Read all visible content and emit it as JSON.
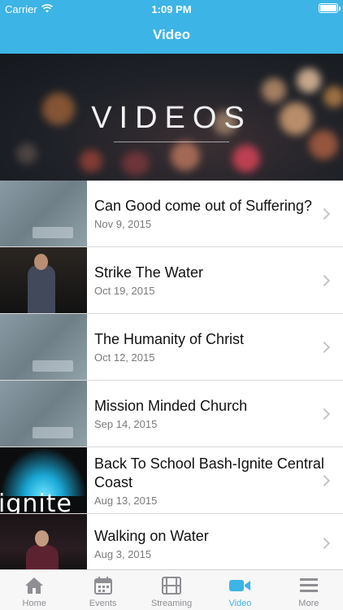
{
  "status_bar": {
    "carrier": "Carrier",
    "time": "1:09 PM"
  },
  "nav": {
    "title": "Video"
  },
  "banner": {
    "text": "VIDEOS"
  },
  "videos": [
    {
      "title": "Can Good come out of Suffering?",
      "date": "Nov 9, 2015",
      "thumb": "scripture"
    },
    {
      "title": "Strike The Water",
      "date": "Oct 19, 2015",
      "thumb": "stage"
    },
    {
      "title": "The Humanity of Christ",
      "date": "Oct 12, 2015",
      "thumb": "scripture"
    },
    {
      "title": "Mission Minded Church",
      "date": "Sep 14, 2015",
      "thumb": "scripture"
    },
    {
      "title": "Back To School Bash-Ignite Central Coast",
      "date": "Aug 13, 2015",
      "thumb": "ignite"
    },
    {
      "title": "Walking on Water",
      "date": "Aug 3, 2015",
      "thumb": "stage2"
    }
  ],
  "thumb_text": {
    "ignite": "ignite"
  },
  "tabs": [
    {
      "label": "Home",
      "icon": "home-icon"
    },
    {
      "label": "Events",
      "icon": "calendar-icon"
    },
    {
      "label": "Streaming",
      "icon": "film-icon"
    },
    {
      "label": "Video",
      "icon": "video-camera-icon"
    },
    {
      "label": "More",
      "icon": "menu-icon"
    }
  ],
  "colors": {
    "accent": "#3cb4e5",
    "tab_inactive": "#8e8e93"
  }
}
